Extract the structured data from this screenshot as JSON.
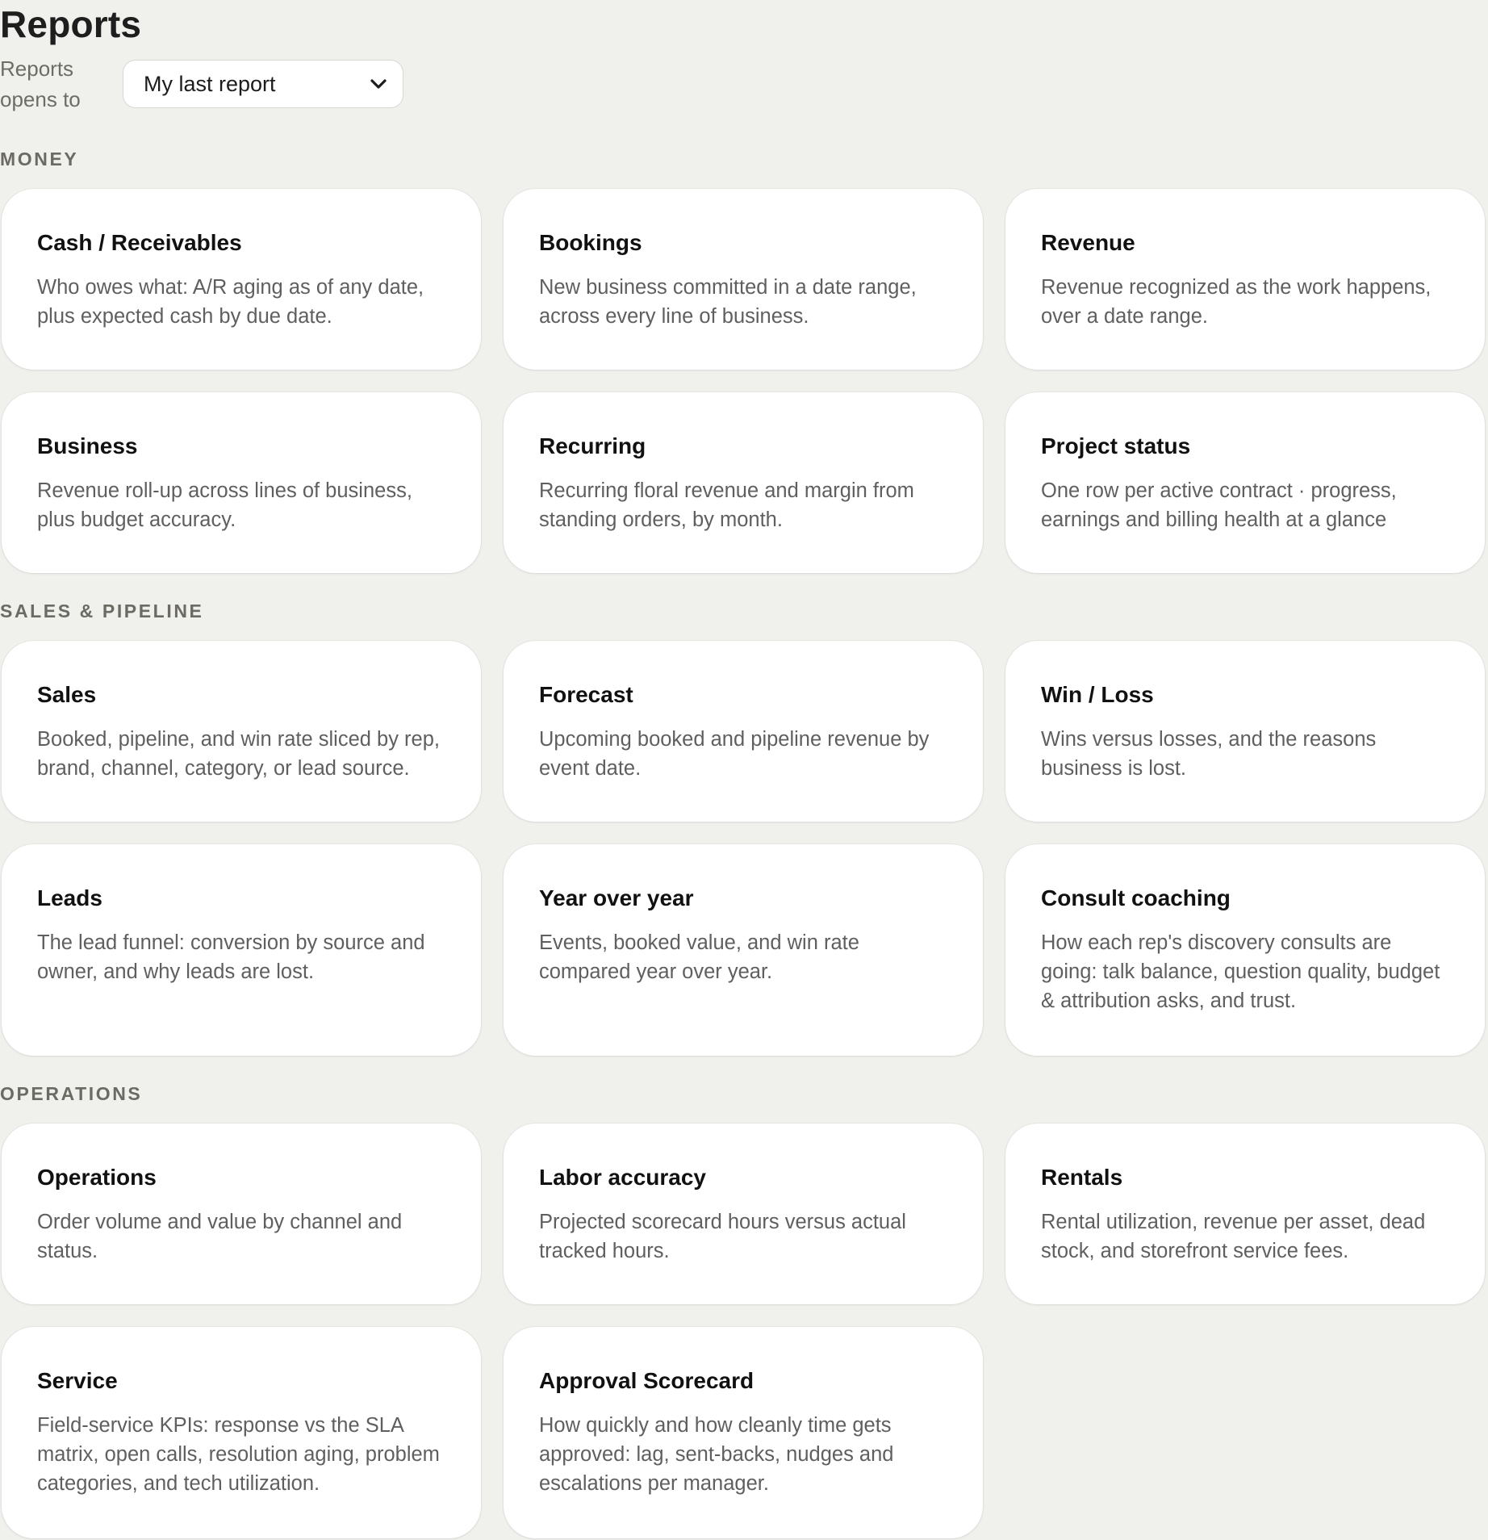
{
  "page": {
    "title": "Reports"
  },
  "opens_to": {
    "label": "Reports opens to",
    "selected": "My last report"
  },
  "sections": [
    {
      "heading": "MONEY",
      "cards": [
        {
          "title": "Cash / Receivables",
          "description": "Who owes what: A/R aging as of any date, plus expected cash by due date."
        },
        {
          "title": "Bookings",
          "description": "New business committed in a date range, across every line of business."
        },
        {
          "title": "Revenue",
          "description": "Revenue recognized as the work happens, over a date range."
        },
        {
          "title": "Business",
          "description": "Revenue roll-up across lines of business, plus budget accuracy."
        },
        {
          "title": "Recurring",
          "description": "Recurring floral revenue and margin from standing orders, by month."
        },
        {
          "title": "Project status",
          "description": "One row per active contract · progress, earnings and billing health at a glance"
        }
      ]
    },
    {
      "heading": "SALES & PIPELINE",
      "cards": [
        {
          "title": "Sales",
          "description": "Booked, pipeline, and win rate sliced by rep, brand, channel, category, or lead source."
        },
        {
          "title": "Forecast",
          "description": "Upcoming booked and pipeline revenue by event date."
        },
        {
          "title": "Win / Loss",
          "description": "Wins versus losses, and the reasons business is lost."
        },
        {
          "title": "Leads",
          "description": "The lead funnel: conversion by source and owner, and why leads are lost."
        },
        {
          "title": "Year over year",
          "description": "Events, booked value, and win rate compared year over year."
        },
        {
          "title": "Consult coaching",
          "description": "How each rep's discovery consults are going: talk balance, question quality, budget & attribution asks, and trust."
        }
      ]
    },
    {
      "heading": "OPERATIONS",
      "cards": [
        {
          "title": "Operations",
          "description": "Order volume and value by channel and status."
        },
        {
          "title": "Labor accuracy",
          "description": "Projected scorecard hours versus actual tracked hours."
        },
        {
          "title": "Rentals",
          "description": "Rental utilization, revenue per asset, dead stock, and storefront service fees."
        },
        {
          "title": "Service",
          "description": "Field-service KPIs: response vs the SLA matrix, open calls, resolution aging, problem categories, and tech utilization."
        },
        {
          "title": "Approval Scorecard",
          "description": "How quickly and how cleanly time gets approved: lag, sent-backs, nudges and escalations per manager."
        }
      ]
    }
  ],
  "icons": {
    "select_chevron": "chevron-down-icon"
  }
}
